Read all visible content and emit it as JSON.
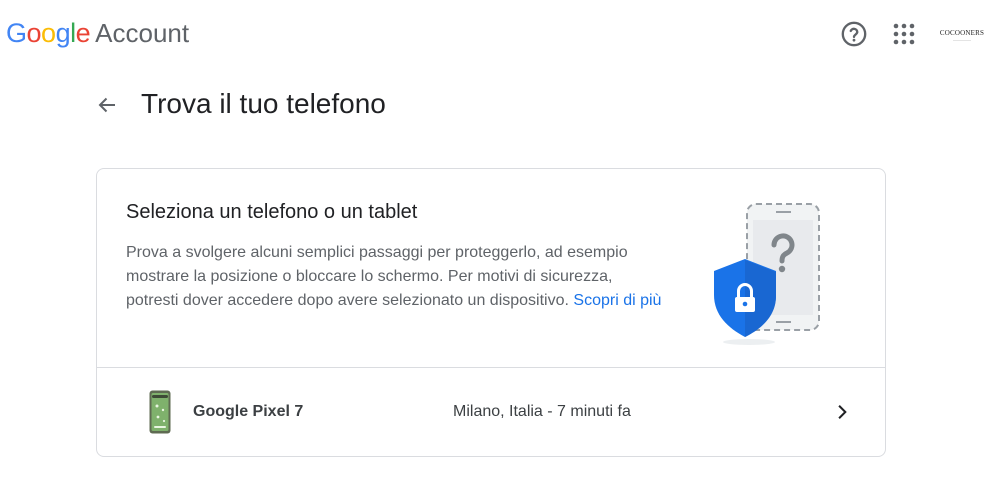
{
  "header": {
    "logo_letters": [
      "G",
      "o",
      "o",
      "g",
      "l",
      "e"
    ],
    "logo_colors": [
      "#4285f4",
      "#ea4335",
      "#fbbc05",
      "#4285f4",
      "#34a853",
      "#ea4335"
    ],
    "product_name": "Account",
    "help_icon": "help-circle-icon",
    "apps_icon": "apps-grid-icon",
    "avatar_brand": "COCOONERS",
    "avatar_sub": "——————"
  },
  "page": {
    "back_icon": "arrow-back-icon",
    "title": "Trova il tuo telefono"
  },
  "card": {
    "title": "Seleziona un telefono o un tablet",
    "description": "Prova a svolgere alcuni semplici passaggi per proteggerlo, ad esempio mostrare la posizione o bloccare lo schermo. Per motivi di sicurezza, potresti dover accedere dopo avere selezionato un dispositivo.",
    "link_label": "Scopri di più",
    "illustration": "phone-question-shield-lock-illustration"
  },
  "device": {
    "name": "Google Pixel 7",
    "location": "Milano, Italia - 7 minuti fa",
    "chevron_icon": "chevron-right-icon"
  },
  "colors": {
    "link": "#1a73e8",
    "shield": "#1a73e8",
    "text_primary": "#202124",
    "text_secondary": "#5f6368",
    "divider": "#dadce0"
  }
}
